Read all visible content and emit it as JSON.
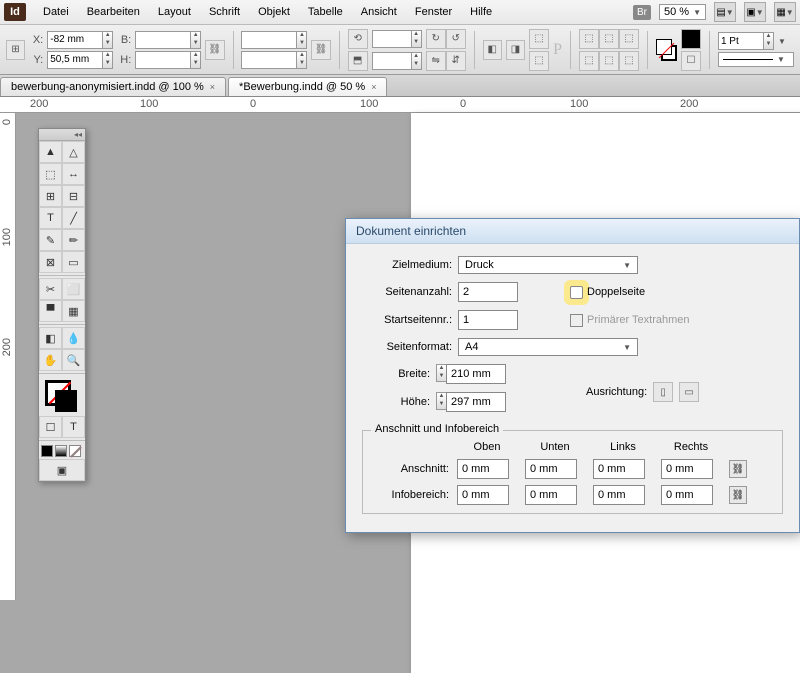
{
  "menu": {
    "items": [
      "Datei",
      "Bearbeiten",
      "Layout",
      "Schrift",
      "Objekt",
      "Tabelle",
      "Ansicht",
      "Fenster",
      "Hilfe"
    ],
    "br": "Br",
    "zoom": "50 %"
  },
  "control": {
    "x_label": "X:",
    "y_label": "Y:",
    "x": "-82 mm",
    "y": "50,5 mm",
    "w_label": "B:",
    "h_label": "H:",
    "w": "",
    "h": "",
    "stroke_weight": "1 Pt"
  },
  "tabs": [
    {
      "label": "bewerbung-anonymisiert.indd @ 100 %"
    },
    {
      "label": "*Bewerbung.indd @ 50 %"
    }
  ],
  "ruler_h": [
    "200",
    "100",
    "0",
    "100",
    "0",
    "100",
    "200"
  ],
  "ruler_v": [
    "0",
    "100",
    "200"
  ],
  "dialog": {
    "title": "Dokument einrichten",
    "intent_label": "Zielmedium:",
    "intent": "Druck",
    "pages_label": "Seitenanzahl:",
    "pages": "2",
    "facing_label": "Doppelseite",
    "start_label": "Startseitennr.:",
    "start": "1",
    "primary_label": "Primärer Textrahmen",
    "pagesize_label": "Seitenformat:",
    "pagesize": "A4",
    "width_label": "Breite:",
    "width": "210 mm",
    "height_label": "Höhe:",
    "height": "297 mm",
    "orient_label": "Ausrichtung:",
    "bleed_legend": "Anschnitt und Infobereich",
    "cols": [
      "Oben",
      "Unten",
      "Links",
      "Rechts"
    ],
    "bleed_label": "Anschnitt:",
    "bleed": [
      "0 mm",
      "0 mm",
      "0 mm",
      "0 mm"
    ],
    "slug_label": "Infobereich:",
    "slug": [
      "0 mm",
      "0 mm",
      "0 mm",
      "0 mm"
    ]
  }
}
